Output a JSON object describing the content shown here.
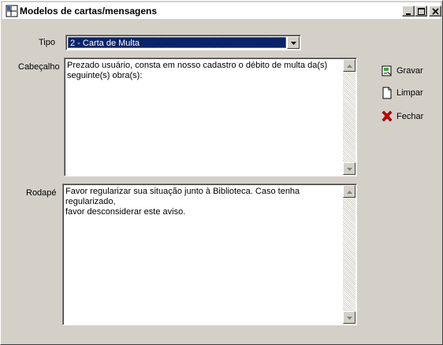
{
  "window": {
    "title": "Modelos de cartas/mensagens"
  },
  "form": {
    "tipo_label": "Tipo",
    "tipo_value": "2 - Carta de Multa",
    "cabecalho_label": "Cabeçalho",
    "cabecalho_text": "Prezado usuário, consta em nosso cadastro o débito de multa da(s)\nseguinte(s) obra(s):",
    "rodape_label": "Rodapé",
    "rodape_text": "Favor regularizar sua situação junto à Biblioteca. Caso tenha regularizado,\nfavor desconsiderar este aviso."
  },
  "actions": {
    "gravar": "Gravar",
    "limpar": "Limpar",
    "fechar": "Fechar"
  },
  "icons": {
    "app": "app-form-icon",
    "minimize": "minimize-icon",
    "maximize": "maximize-icon",
    "close": "close-icon",
    "gravar": "save-icon",
    "limpar": "blank-page-icon",
    "fechar": "red-x-icon",
    "dropdown": "chevron-down-icon"
  },
  "colors": {
    "window_bg": "#d4d0c8",
    "selection": "#0a246a",
    "close_red": "#cc0000"
  }
}
